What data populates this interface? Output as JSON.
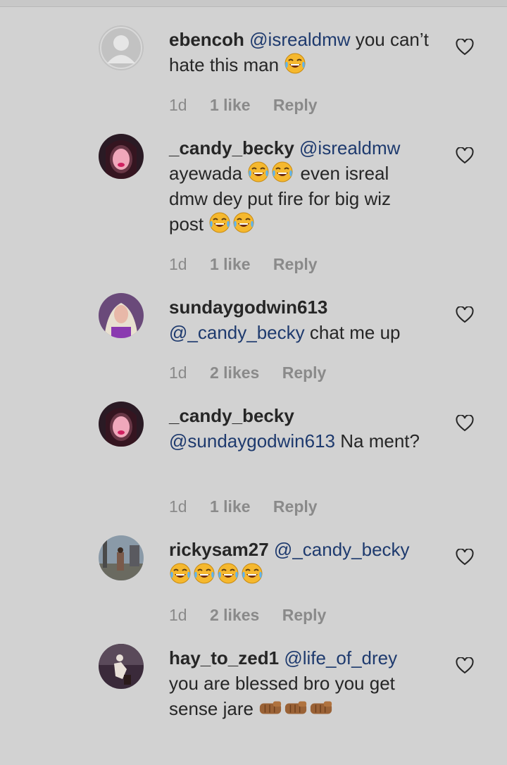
{
  "comments": [
    {
      "username": "ebencoh",
      "mention": "@isrealdmw",
      "text": "you can’t hate this man",
      "emoji_after": "laugh-cry x1",
      "time": "1d",
      "likes": "1 like",
      "reply": "Reply",
      "avatar": "default-avatar-icon"
    },
    {
      "username": "_candy_becky",
      "mention": "@isrealdmw",
      "text": "ayewada",
      "text2": "even isreal dmw dey put fire for big wiz post",
      "time": "1d",
      "likes": "1 like",
      "reply": "Reply",
      "avatar": "user-photo-avatar"
    },
    {
      "username": "sundaygodwin613",
      "mention": "@_candy_becky",
      "text": "chat me up",
      "time": "1d",
      "likes": "2 likes",
      "reply": "Reply",
      "avatar": "user-photo-avatar"
    },
    {
      "username": "_candy_becky",
      "mention": "@sundaygodwin613",
      "text": "Na ment?",
      "time": "1d",
      "likes": "1 like",
      "reply": "Reply",
      "avatar": "user-photo-avatar"
    },
    {
      "username": "rickysam27",
      "mention": "@_candy_becky",
      "text": "",
      "time": "1d",
      "likes": "2 likes",
      "reply": "Reply",
      "avatar": "user-photo-avatar"
    },
    {
      "username": "hay_to_zed1",
      "mention": "@life_of_drey",
      "text": "you are blessed bro you get sense jare",
      "time": "",
      "likes": "",
      "reply": "",
      "avatar": "user-photo-avatar"
    }
  ],
  "colors": {
    "background": "#d2d2d2",
    "text": "#262626",
    "mention": "#1e3a6e",
    "meta": "#8a8a8a"
  }
}
